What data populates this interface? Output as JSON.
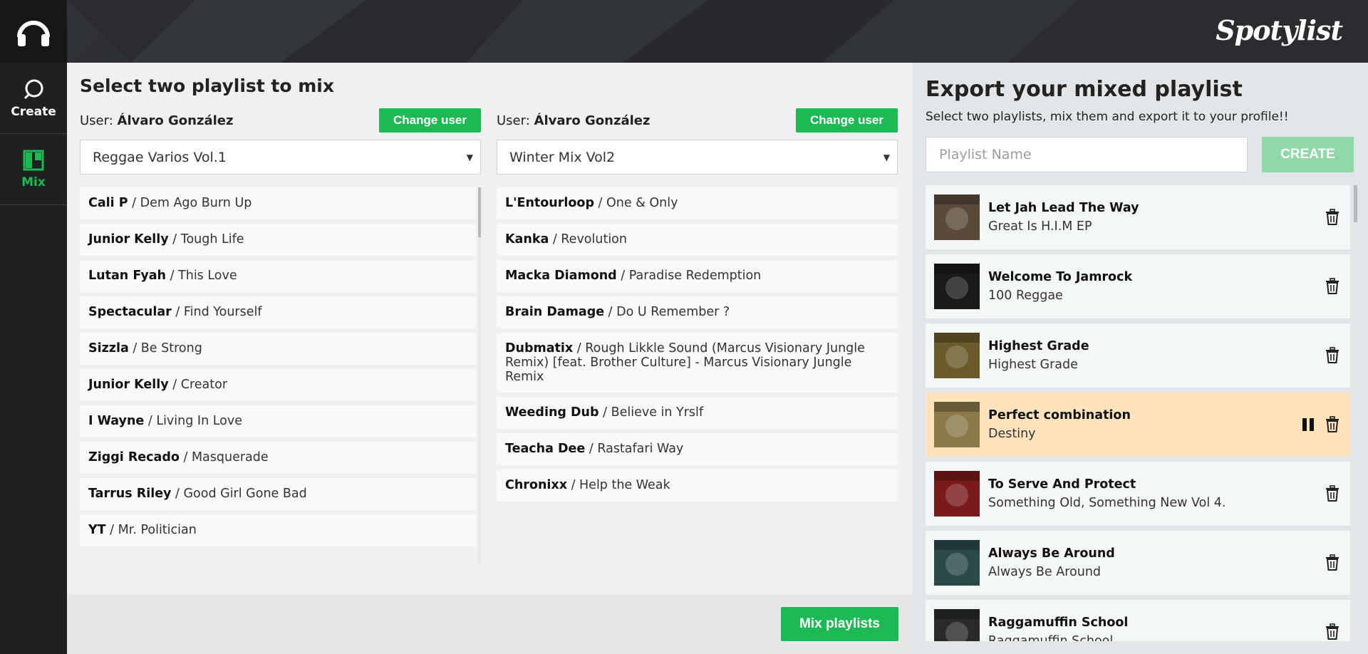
{
  "app": {
    "brand": "Spotylist",
    "logo_icon": "headphones-icon"
  },
  "sidebar": {
    "items": [
      {
        "label": "Create",
        "icon": "create-ring-icon"
      },
      {
        "label": "Mix",
        "icon": "mix-columns-icon",
        "active": true
      }
    ]
  },
  "main": {
    "title": "Select two playlist to mix",
    "left": {
      "user_prefix": "User:",
      "user_name": "Álvaro González",
      "change_user_label": "Change user",
      "playlist_selected": "Reggae Varios Vol.1",
      "tracks": [
        {
          "artist": "Cali P",
          "song": " / Dem Ago Burn Up"
        },
        {
          "artist": "Junior Kelly",
          "song": " / Tough Life"
        },
        {
          "artist": "Lutan Fyah",
          "song": " / This Love"
        },
        {
          "artist": "Spectacular",
          "song": " / Find Yourself"
        },
        {
          "artist": "Sizzla",
          "song": " / Be Strong"
        },
        {
          "artist": "Junior Kelly",
          "song": " / Creator"
        },
        {
          "artist": "I Wayne",
          "song": " / Living In Love"
        },
        {
          "artist": "Ziggi Recado",
          "song": " / Masquerade"
        },
        {
          "artist": "Tarrus Riley",
          "song": " / Good Girl Gone Bad"
        },
        {
          "artist": "YT",
          "song": " / Mr. Politician"
        }
      ]
    },
    "right": {
      "user_prefix": "User:",
      "user_name": "Álvaro González",
      "change_user_label": "Change user",
      "playlist_selected": "Winter Mix Vol2",
      "tracks": [
        {
          "artist": "L'Entourloop",
          "song": " / One & Only"
        },
        {
          "artist": "Kanka",
          "song": " / Revolution"
        },
        {
          "artist": "Macka Diamond",
          "song": " / Paradise Redemption"
        },
        {
          "artist": "Brain Damage",
          "song": " / Do U Remember ?"
        },
        {
          "artist": "Dubmatix",
          "song": " / Rough Likkle Sound (Marcus Visionary Jungle Remix) [feat. Brother Culture] - Marcus Visionary Jungle Remix"
        },
        {
          "artist": "Weeding Dub",
          "song": " / Believe in Yrslf"
        },
        {
          "artist": "Teacha Dee",
          "song": " / Rastafari Way"
        },
        {
          "artist": "Chronixx",
          "song": " / Help the Weak"
        }
      ]
    },
    "mix_button_label": "Mix playlists"
  },
  "export": {
    "title": "Export your mixed playlist",
    "subtitle": "Select two playlists, mix them and export it to your profile!!",
    "name_placeholder": "Playlist Name",
    "create_label": "CREATE",
    "tracks": [
      {
        "title": "Let Jah Lead The Way",
        "album": "Great Is H.I.M EP",
        "cover_color": "#5a4a3a"
      },
      {
        "title": "Welcome To Jamrock",
        "album": "100 Reggae",
        "cover_color": "#1a1a1a"
      },
      {
        "title": "Highest Grade",
        "album": "Highest Grade",
        "cover_color": "#6b5a2a"
      },
      {
        "title": "Perfect combination",
        "album": "Destiny",
        "cover_color": "#8a7a4a",
        "playing": true
      },
      {
        "title": "To Serve And Protect",
        "album": "Something Old, Something New Vol 4.",
        "cover_color": "#7a1a1a"
      },
      {
        "title": "Always Be Around",
        "album": "Always Be Around",
        "cover_color": "#2a4a4a"
      },
      {
        "title": "Raggamuffin School",
        "album": "Raggamuffin School",
        "cover_color": "#2a2a2a"
      }
    ]
  }
}
